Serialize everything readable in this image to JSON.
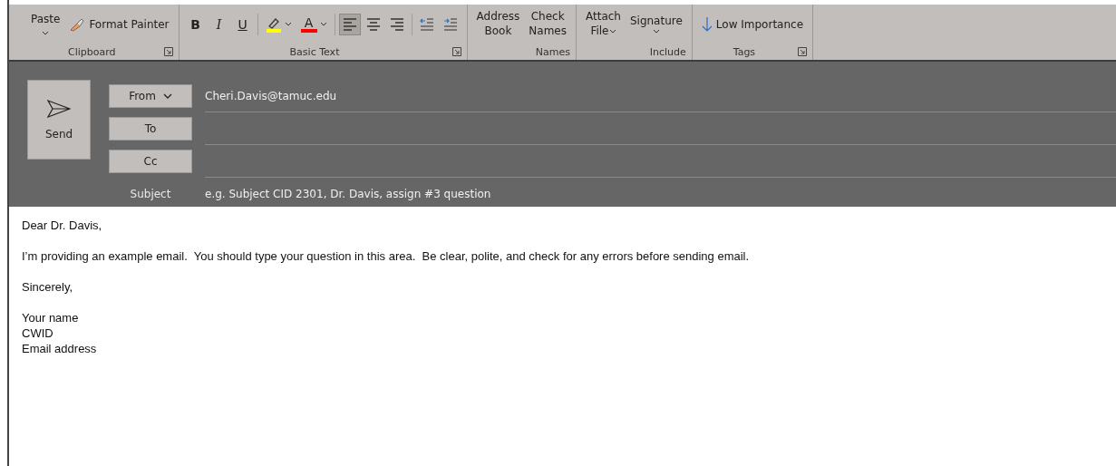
{
  "ribbon": {
    "groups": [
      {
        "label": "Clipboard",
        "launcher": true,
        "items": [
          {
            "kind": "paste",
            "label": "Paste"
          },
          {
            "kind": "painter",
            "label": "Format Painter"
          }
        ]
      },
      {
        "label": "Basic Text",
        "launcher": true,
        "items": [
          {
            "kind": "bold",
            "label": "B"
          },
          {
            "kind": "italic",
            "label": "I"
          },
          {
            "kind": "underline",
            "label": "U"
          },
          {
            "kind": "highlight",
            "color": "#ffff00"
          },
          {
            "kind": "fontcolor",
            "label": "A",
            "color": "#ff0000"
          },
          {
            "kind": "alignleft",
            "selected": true
          },
          {
            "kind": "aligncenter",
            "selected": false
          },
          {
            "kind": "alignright",
            "selected": false
          },
          {
            "kind": "outdent"
          },
          {
            "kind": "indent"
          }
        ]
      },
      {
        "label": "Names",
        "launcher": false,
        "items": [
          {
            "kind": "stack",
            "lines": [
              "Address",
              "Book"
            ]
          },
          {
            "kind": "stack",
            "lines": [
              "Check",
              "Names"
            ]
          }
        ]
      },
      {
        "label": "Include",
        "launcher": false,
        "items": [
          {
            "kind": "stackdrop",
            "lines": [
              "Attach",
              "File"
            ]
          },
          {
            "kind": "stackdrop",
            "lines": [
              "Signature"
            ]
          }
        ]
      },
      {
        "label": "Tags",
        "launcher": true,
        "items": [
          {
            "kind": "importance",
            "label": "Low Importance"
          }
        ]
      }
    ]
  },
  "compose": {
    "send": {
      "label": "Send"
    },
    "fields": [
      {
        "kind": "dropdown",
        "label": "From",
        "value": "Cheri.Davis@tamuc.edu"
      },
      {
        "kind": "button",
        "label": "To"
      },
      {
        "kind": "button",
        "label": "Cc"
      },
      {
        "kind": "plain",
        "label": "Subject",
        "value": "e.g. Subject CID 2301, Dr. Davis, assign #3 question"
      }
    ]
  },
  "body": {
    "paragraphs": [
      [
        "Dear Dr. Davis,"
      ],
      [
        "I’m providing an example email.  You should type your question in this area.  Be clear, polite, and check for any errors before sending email."
      ],
      [
        "Sincerely,"
      ],
      [
        "Your name",
        "CWID",
        "Email address"
      ]
    ]
  }
}
